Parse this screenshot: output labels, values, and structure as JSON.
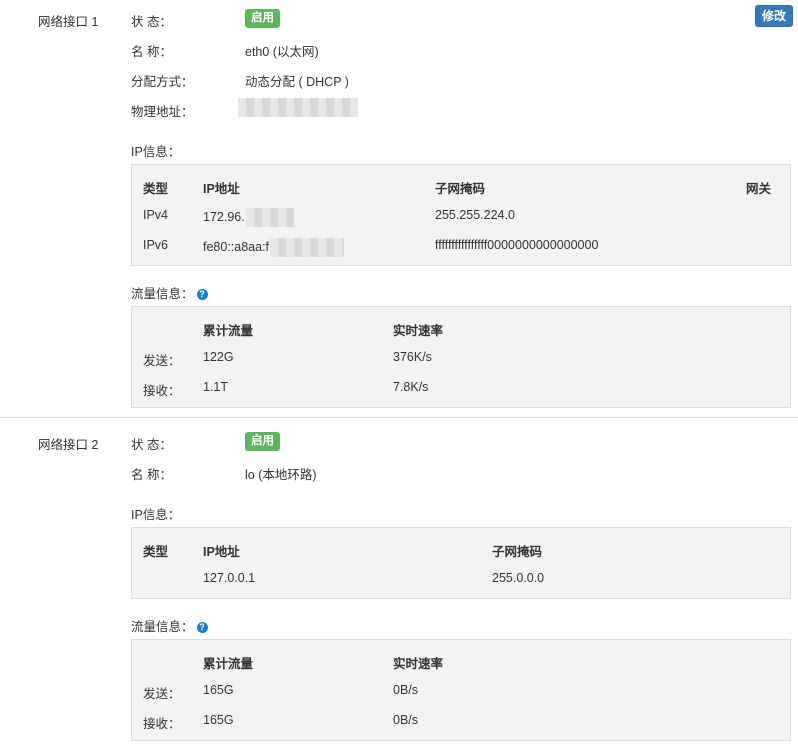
{
  "interfaces": [
    {
      "title": "网络接口 1",
      "edit_label": "修改",
      "status_label": "状 态：",
      "status_value": "启用",
      "name_label": "名 称：",
      "name_value": "eth0 (以太网)",
      "alloc_label": "分配方式：",
      "alloc_value": "动态分配 ( DHCP )",
      "mac_label": "物理地址：",
      "ip_label": "IP信息：",
      "ip_headers": [
        "类型",
        "IP地址",
        "子网掩码",
        "网关"
      ],
      "ip_rows": [
        [
          "IPv4",
          "172.96.",
          "255.255.224.0"
        ],
        [
          "IPv6",
          "fe80::a8aa:f",
          "ffffffffffffffff0000000000000000"
        ]
      ],
      "traffic_label": "流量信息：",
      "traffic_headers": [
        "累计流量",
        "实时速率"
      ],
      "traffic_rows": [
        [
          "发送：",
          "122G",
          "376K/s"
        ],
        [
          "接收：",
          "1.1T",
          "7.8K/s"
        ]
      ]
    },
    {
      "title": "网络接口 2",
      "status_label": "状 态：",
      "status_value": "启用",
      "name_label": "名 称：",
      "name_value": "lo (本地环路)",
      "ip_label": "IP信息：",
      "ip_headers": [
        "类型",
        "IP地址",
        "子网掩码"
      ],
      "ip_rows": [
        [
          "",
          "127.0.0.1",
          "255.0.0.0"
        ]
      ],
      "traffic_label": "流量信息：",
      "traffic_headers": [
        "累计流量",
        "实时速率"
      ],
      "traffic_rows": [
        [
          "发送：",
          "165G",
          "0B/s"
        ],
        [
          "接收：",
          "165G",
          "0B/s"
        ]
      ]
    }
  ],
  "icons": {
    "help": "help-circle-icon"
  },
  "colors": {
    "badge_green": "#5cb85c",
    "button_blue": "#337ab7",
    "help_blue": "#1a7fd0"
  }
}
